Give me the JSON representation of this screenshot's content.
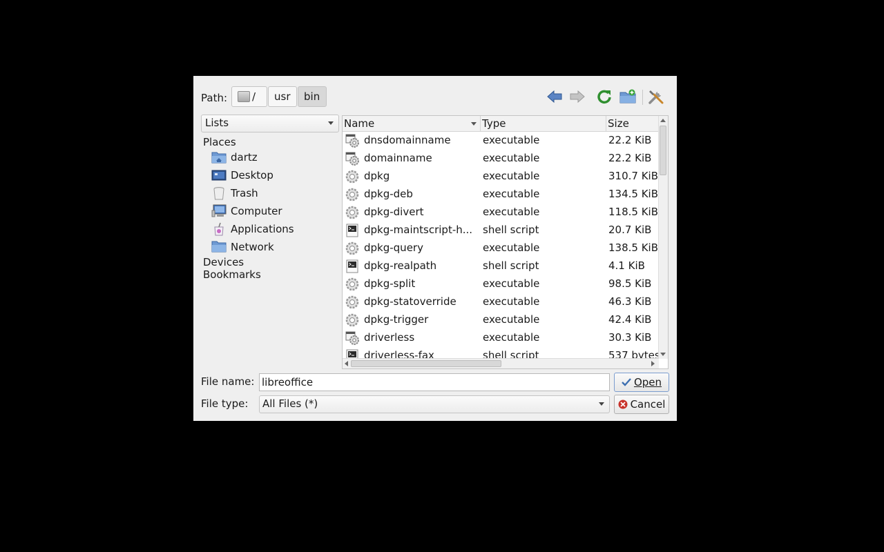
{
  "path": {
    "label": "Path:",
    "crumbs": [
      "/",
      "usr",
      "bin"
    ]
  },
  "view_mode": {
    "selected": "Lists"
  },
  "sidebar": {
    "places_heading": "Places",
    "places": [
      {
        "label": "dartz",
        "icon": "home-folder-icon"
      },
      {
        "label": "Desktop",
        "icon": "desktop-icon"
      },
      {
        "label": "Trash",
        "icon": "trash-icon"
      },
      {
        "label": "Computer",
        "icon": "computer-icon"
      },
      {
        "label": "Applications",
        "icon": "applications-icon"
      },
      {
        "label": "Network",
        "icon": "network-folder-icon"
      }
    ],
    "devices_heading": "Devices",
    "bookmarks_heading": "Bookmarks"
  },
  "file_list": {
    "columns": [
      "Name",
      "Type",
      "Size"
    ],
    "rows": [
      {
        "name": "dnsdomainname",
        "type": "executable",
        "size": "22.2 KiB",
        "icon": "executable-icon"
      },
      {
        "name": "domainname",
        "type": "executable",
        "size": "22.2 KiB",
        "icon": "executable-icon"
      },
      {
        "name": "dpkg",
        "type": "executable",
        "size": "310.7 KiB",
        "icon": "gear-icon"
      },
      {
        "name": "dpkg-deb",
        "type": "executable",
        "size": "134.5 KiB",
        "icon": "gear-icon"
      },
      {
        "name": "dpkg-divert",
        "type": "executable",
        "size": "118.5 KiB",
        "icon": "gear-icon"
      },
      {
        "name": "dpkg-maintscript-h...",
        "type": "shell script",
        "size": "20.7 KiB",
        "icon": "script-icon"
      },
      {
        "name": "dpkg-query",
        "type": "executable",
        "size": "138.5 KiB",
        "icon": "gear-icon"
      },
      {
        "name": "dpkg-realpath",
        "type": "shell script",
        "size": "4.1 KiB",
        "icon": "script-icon"
      },
      {
        "name": "dpkg-split",
        "type": "executable",
        "size": "98.5 KiB",
        "icon": "gear-icon"
      },
      {
        "name": "dpkg-statoverride",
        "type": "executable",
        "size": "46.3 KiB",
        "icon": "gear-icon"
      },
      {
        "name": "dpkg-trigger",
        "type": "executable",
        "size": "42.4 KiB",
        "icon": "gear-icon"
      },
      {
        "name": "driverless",
        "type": "executable",
        "size": "30.3 KiB",
        "icon": "executable-icon"
      },
      {
        "name": "driverless-fax",
        "type": "shell script",
        "size": "537 bytes",
        "icon": "script-icon"
      }
    ]
  },
  "file_name": {
    "label": "File name:",
    "value": "libreoffice"
  },
  "file_type": {
    "label": "File type:",
    "value": "All Files (*)"
  },
  "buttons": {
    "open": "Open",
    "cancel": "Cancel"
  }
}
